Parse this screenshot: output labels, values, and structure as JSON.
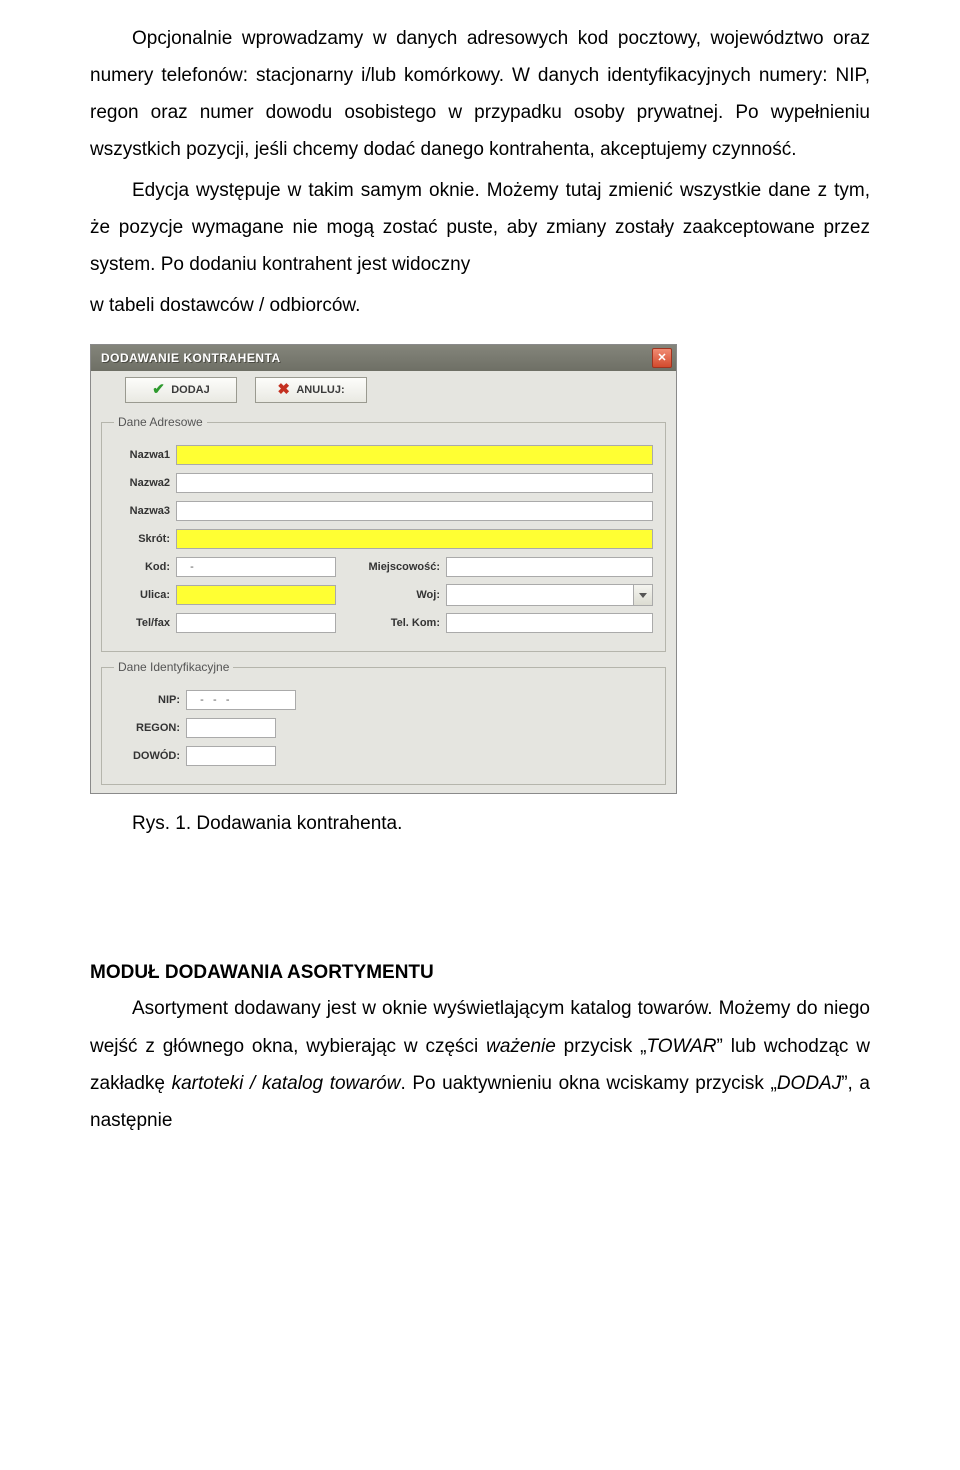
{
  "para1": "Opcjonalnie wprowadzamy w danych adresowych kod pocztowy, województwo oraz numery telefonów: stacjonarny i/lub komórkowy. W danych identyfikacyjnych numery: NIP, regon oraz numer dowodu osobistego w przypadku osoby prywatnej. Po wypełnieniu wszystkich pozycji, jeśli chcemy dodać danego kontrahenta, akceptujemy czynność.",
  "para2": "Edycja występuje w takim samym oknie. Możemy tutaj zmienić wszystkie dane z tym, że pozycje wymagane nie mogą zostać puste, aby zmiany zostały zaakceptowane przez system. Po dodaniu kontrahent jest widoczny",
  "para2b": "w tabeli  dostawców / odbiorców.",
  "dialog": {
    "title": "DODAWANIE KONTRAHENTA",
    "btn_add": "DODAJ",
    "btn_cancel": "ANULUJ:",
    "group_addr": "Dane Adresowe",
    "labels": {
      "nazwa1": "Nazwa1",
      "nazwa2": "Nazwa2",
      "nazwa3": "Nazwa3",
      "skrot": "Skrót:",
      "kod": "Kod:",
      "miejscowosc": "Miejscowość:",
      "ulica": "Ulica:",
      "woj": "Woj:",
      "telfax": "Tel/fax",
      "telkom": "Tel. Kom:"
    },
    "kod_value": "   -",
    "group_id": "Dane Identyfikacyjne",
    "labels_id": {
      "nip": "NIP:",
      "regon": "REGON:",
      "dowod": "DOWÓD:"
    },
    "nip_value": "   -   -   -"
  },
  "caption": "Rys. 1. Dodawania kontrahenta.",
  "section_heading": "MODUŁ DODAWANIA ASORTYMENTU",
  "para3_plain1": "Asortyment  dodawany jest w oknie wyświetlającym katalog towarów. Możemy do niego wejść z głównego okna, wybierając w części ",
  "para3_it1": "ważenie",
  "para3_plain2": " przycisk „",
  "para3_it2": "TOWAR",
  "para3_plain3": "” lub wchodząc w zakładkę ",
  "para3_it3": "kartoteki / katalog towarów",
  "para3_plain4": ". Po uaktywnieniu okna wciskamy przycisk „",
  "para3_it4": "DODAJ",
  "para3_plain5": "”, a następnie"
}
